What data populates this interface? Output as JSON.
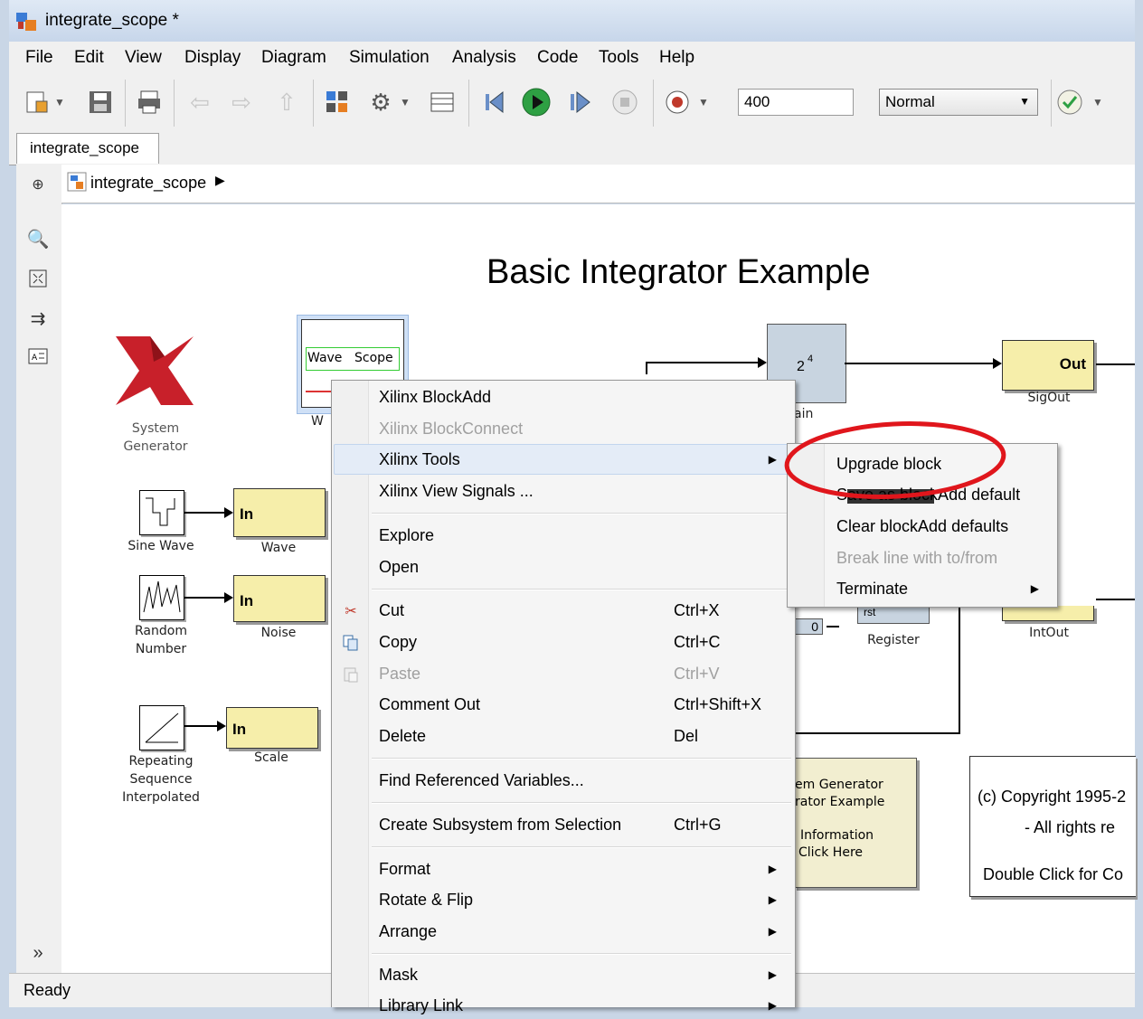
{
  "window": {
    "title": "integrate_scope *"
  },
  "menubar": [
    "File",
    "Edit",
    "View",
    "Display",
    "Diagram",
    "Simulation",
    "Analysis",
    "Code",
    "Tools",
    "Help"
  ],
  "toolbar": {
    "stop_time": "400",
    "sim_mode": "Normal"
  },
  "tab": {
    "label": "integrate_scope"
  },
  "breadcrumb": {
    "label": "integrate_scope"
  },
  "status": {
    "text": "Ready"
  },
  "diagram": {
    "title": "Basic Integrator Example",
    "system_generator": {
      "line1": "System",
      "line2": "Generator"
    },
    "wavescope": {
      "wave": "Wave",
      "scope": "Scope",
      "label_partial": "W"
    },
    "gain": {
      "value": "2",
      "exp": "4",
      "label_partial": "ain"
    },
    "sigout": {
      "port": "Out",
      "label": "SigOut"
    },
    "intout": {
      "port": "Out",
      "label": "IntOut"
    },
    "register": {
      "label": "Register",
      "port_partial": "rst"
    },
    "constant_partial": "0",
    "sine_wave": {
      "label": "Sine Wave"
    },
    "random_number": {
      "line1": "Random",
      "line2": "Number"
    },
    "repeating": {
      "line1": "Repeating",
      "line2": "Sequence",
      "line3": "Interpolated"
    },
    "gateway_in": {
      "port": "In"
    },
    "gateway_labels": {
      "wave": "Wave",
      "noise": "Noise",
      "scale": "Scale"
    },
    "info_block": {
      "line1": "em Generator",
      "line2": "rator Example",
      "line3": "Information",
      "line4": "Click Here"
    },
    "copyright": {
      "line1": "(c) Copyright 1995-2",
      "line2": "- All rights re",
      "line3": "Double Click for Co"
    }
  },
  "context_menu": {
    "items": [
      {
        "label": "Xilinx BlockAdd"
      },
      {
        "label": "Xilinx BlockConnect",
        "disabled": true
      },
      {
        "label": "Xilinx Tools",
        "submenu": true,
        "highlighted": true
      },
      {
        "label": "Xilinx View Signals ..."
      },
      {
        "label": "Explore"
      },
      {
        "label": "Open"
      },
      {
        "label": "Cut",
        "shortcut": "Ctrl+X",
        "icon": "scissors-icon"
      },
      {
        "label": "Copy",
        "shortcut": "Ctrl+C",
        "icon": "copy-icon"
      },
      {
        "label": "Paste",
        "shortcut": "Ctrl+V",
        "disabled": true,
        "icon": "paste-icon"
      },
      {
        "label": "Comment Out",
        "shortcut": "Ctrl+Shift+X"
      },
      {
        "label": "Delete",
        "shortcut": "Del"
      },
      {
        "label": "Find Referenced Variables..."
      },
      {
        "label": "Create Subsystem from Selection",
        "shortcut": "Ctrl+G"
      },
      {
        "label": "Format",
        "submenu": true
      },
      {
        "label": "Rotate & Flip",
        "submenu": true
      },
      {
        "label": "Arrange",
        "submenu": true
      },
      {
        "label": "Mask",
        "submenu": true
      },
      {
        "label": "Library Link",
        "submenu": true
      }
    ]
  },
  "submenu": {
    "items": [
      {
        "label": "Upgrade block",
        "circled": true
      },
      {
        "label": "Save as blockAdd default",
        "obscured": true
      },
      {
        "label": "Clear blockAdd defaults"
      },
      {
        "label": "Break line with to/from",
        "disabled": true
      },
      {
        "label": "Terminate",
        "submenu": true
      }
    ]
  },
  "colors": {
    "annotation_circle": "#e0161c",
    "xilinx_red": "#c8202a",
    "gateway_fill": "#f6eeaa"
  }
}
